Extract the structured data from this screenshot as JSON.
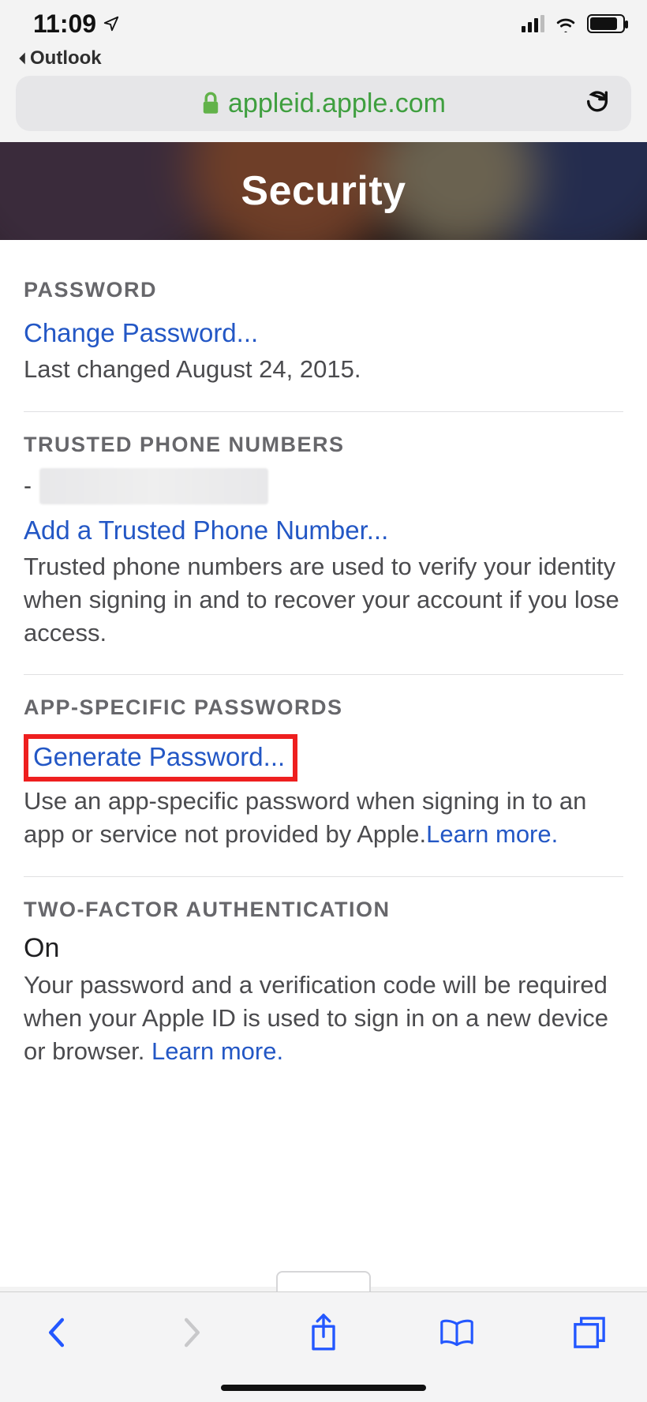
{
  "statusbar": {
    "time": "11:09",
    "back_app": "Outlook"
  },
  "addressbar": {
    "domain": "appleid.apple.com"
  },
  "hero": {
    "title": "Security"
  },
  "sections": {
    "password": {
      "heading": "PASSWORD",
      "change_link": "Change Password...",
      "last_changed": "Last changed August 24, 2015."
    },
    "trusted_numbers": {
      "heading": "TRUSTED PHONE NUMBERS",
      "dash": "-",
      "add_link": "Add a Trusted Phone Number...",
      "description": "Trusted phone numbers are used to verify your identity when signing in and to recover your account if you lose access."
    },
    "app_passwords": {
      "heading": "APP-SPECIFIC PASSWORDS",
      "generate_link": "Generate Password...",
      "description": "Use an app-specific password when signing in to an app or service not provided by Apple.",
      "learn_more": "Learn more."
    },
    "two_factor": {
      "heading": "TWO-FACTOR AUTHENTICATION",
      "status": "On",
      "description": "Your password and a verification code will be required when your Apple ID is used to sign in on a new device or browser. ",
      "learn_more": "Learn more."
    }
  }
}
